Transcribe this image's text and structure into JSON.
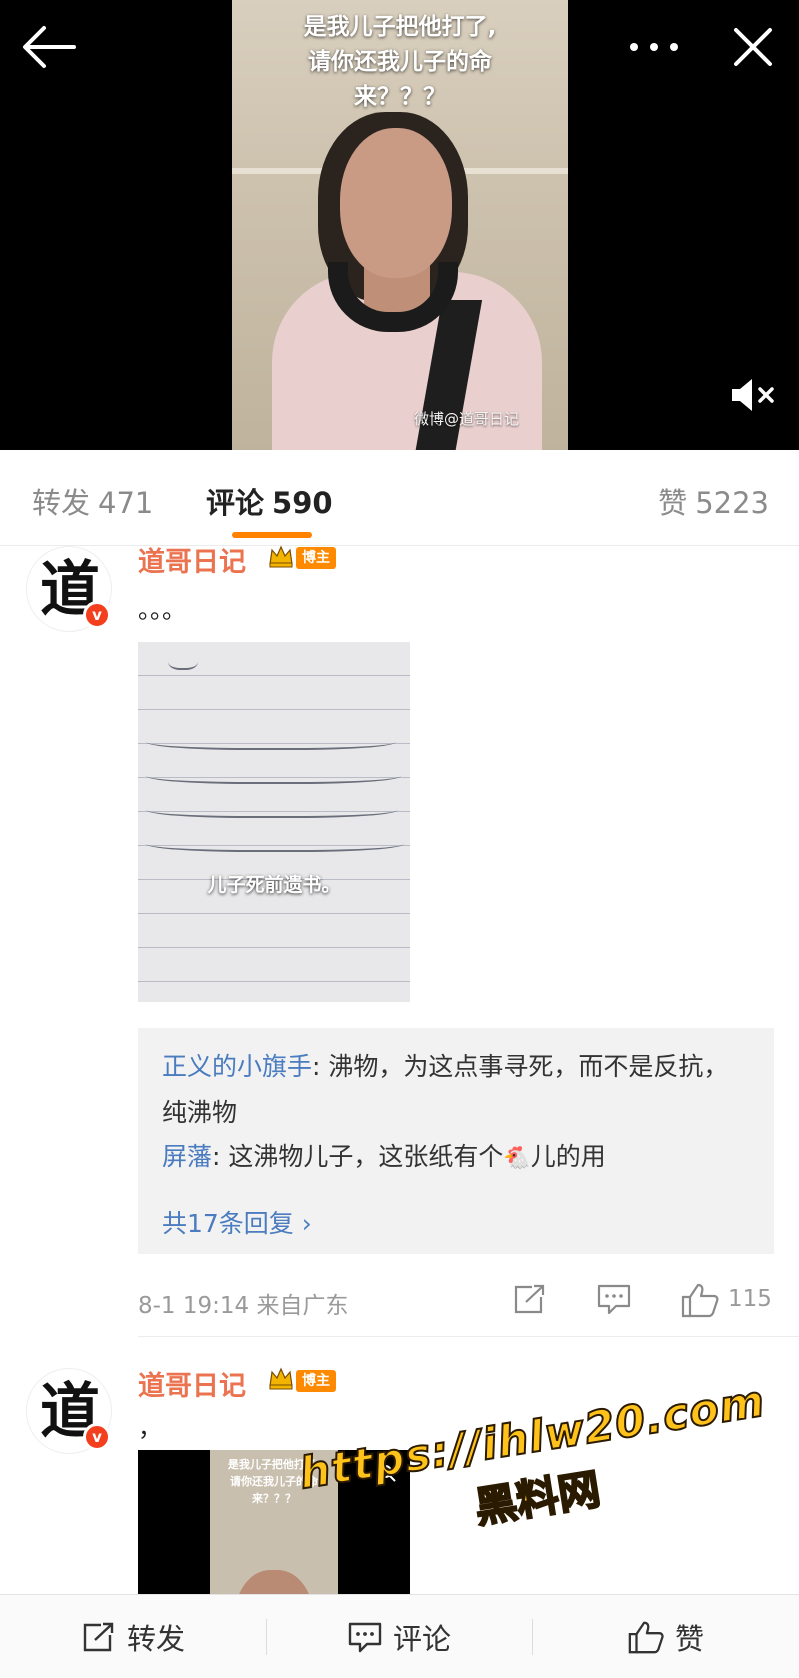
{
  "video": {
    "caption": "是我儿子把他打了,\n请你还我儿子的命\n来？？？",
    "watermark": "微博@道哥日记"
  },
  "tabs": {
    "repost": {
      "label": "转发",
      "count": "471"
    },
    "comment": {
      "label": "评论",
      "count": "590"
    },
    "like": {
      "label": "赞",
      "count": "5223"
    }
  },
  "comments": [
    {
      "author": "道哥日记",
      "avatar_char": "道",
      "badge": "博主",
      "text": "。。。",
      "image_caption": "儿子死前遗书。",
      "replies": [
        {
          "name": "正义的小旗手",
          "text": ": 沸物，为这点事寻死，而不是反抗，纯沸物"
        },
        {
          "name": "屏藩",
          "text_before": ": 这沸物儿子，这张纸有个",
          "emoji": "🐔",
          "text_after": "儿的用"
        }
      ],
      "more_replies": "共17条回复 ›",
      "time": "8-1 19:14",
      "source": "来自广东",
      "likes": "115"
    },
    {
      "author": "道哥日记",
      "avatar_char": "道",
      "badge": "博主",
      "text": "，",
      "thumb_caption": "是我儿子把他打了,\n请你还我儿子的命\n来？？？"
    }
  ],
  "promo": {
    "url": "https://ihlw20.com",
    "site": "黑料网"
  },
  "bottombar": {
    "repost": "转发",
    "comment": "评论",
    "like": "赞"
  },
  "colors": {
    "accent": "#ff8200",
    "author": "#eb7350",
    "link": "#4a7cbf",
    "badge": "#ff8a00"
  }
}
